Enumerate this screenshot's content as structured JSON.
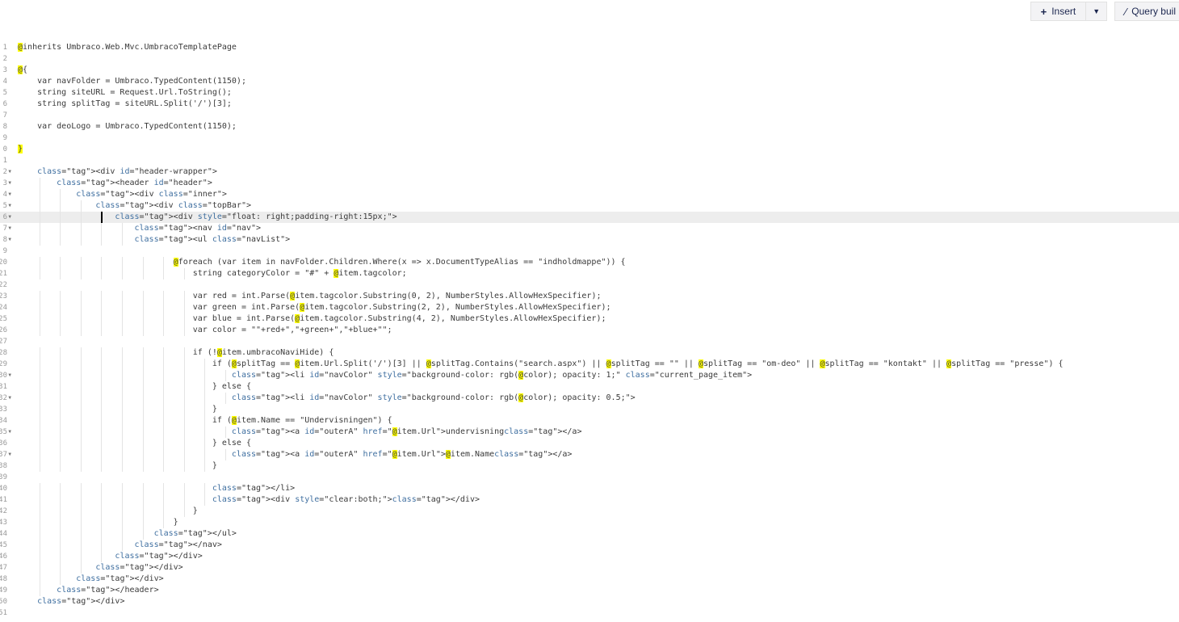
{
  "toolbar": {
    "insert_icon": "plus-icon",
    "insert_label": "Insert",
    "dropdown_icon": "caret-down-icon",
    "query_icon": "wand-icon",
    "query_label": "Query buil"
  },
  "editor": {
    "lines": [
      {
        "n": "1",
        "t": "@inherits Umbraco.Web.Mvc.UmbracoTemplatePage"
      },
      {
        "n": "2",
        "t": ""
      },
      {
        "n": "3",
        "t": "@{"
      },
      {
        "n": "4",
        "t": "    var navFolder = Umbraco.TypedContent(1150);"
      },
      {
        "n": "5",
        "t": "    string siteURL = Request.Url.ToString();"
      },
      {
        "n": "6",
        "t": "    string splitTag = siteURL.Split('/')[3];"
      },
      {
        "n": "7",
        "t": ""
      },
      {
        "n": "8",
        "t": "    var deoLogo = Umbraco.TypedContent(1150);"
      },
      {
        "n": "9",
        "t": ""
      },
      {
        "n": "0",
        "t": "}"
      },
      {
        "n": "1",
        "t": ""
      },
      {
        "n": "2",
        "t": "    <div id=\"header-wrapper\">",
        "fold": true
      },
      {
        "n": "3",
        "t": "        <header id=\"header\">",
        "fold": true
      },
      {
        "n": "4",
        "t": "            <div class=\"inner\">",
        "fold": true
      },
      {
        "n": "5",
        "t": "                <div class=\"topBar\">",
        "fold": true
      },
      {
        "n": "6",
        "t": "                    <div style=\"float: right;padding-right:15px;\">",
        "fold": true,
        "active": true
      },
      {
        "n": "7",
        "t": "                        <nav id=\"nav\">",
        "fold": true
      },
      {
        "n": "8",
        "t": "                        <ul class=\"navList\">",
        "fold": true
      },
      {
        "n": "9",
        "t": ""
      },
      {
        "n": "20",
        "t": "                                @foreach (var item in navFolder.Children.Where(x => x.DocumentTypeAlias == \"indholdmappe\")) {"
      },
      {
        "n": "21",
        "t": "                                    string categoryColor = \"#\" + @item.tagcolor;"
      },
      {
        "n": "22",
        "t": ""
      },
      {
        "n": "23",
        "t": "                                    var red = int.Parse(@item.tagcolor.Substring(0, 2), NumberStyles.AllowHexSpecifier);"
      },
      {
        "n": "24",
        "t": "                                    var green = int.Parse(@item.tagcolor.Substring(2, 2), NumberStyles.AllowHexSpecifier);"
      },
      {
        "n": "25",
        "t": "                                    var blue = int.Parse(@item.tagcolor.Substring(4, 2), NumberStyles.AllowHexSpecifier);"
      },
      {
        "n": "26",
        "t": "                                    var color = \"\"+red+\",\"+green+\",\"+blue+\"\";"
      },
      {
        "n": "27",
        "t": ""
      },
      {
        "n": "28",
        "t": "                                    if (!@item.umbracoNaviHide) {"
      },
      {
        "n": "29",
        "t": "                                        if (@splitTag == @item.Url.Split('/')[3] || @splitTag.Contains(\"search.aspx\") || @splitTag == \"\" || @splitTag == \"om-deo\" || @splitTag == \"kontakt\" || @splitTag == \"presse\") {"
      },
      {
        "n": "30",
        "t": "                                            <li id=\"navColor\" style=\"background-color: rgb(@color); opacity: 1;\" class=\"current_page_item\">",
        "fold": true
      },
      {
        "n": "31",
        "t": "                                        } else {"
      },
      {
        "n": "32",
        "t": "                                            <li id=\"navColor\" style=\"background-color: rgb(@color); opacity: 0.5;\">",
        "fold": true
      },
      {
        "n": "33",
        "t": "                                        }"
      },
      {
        "n": "34",
        "t": "                                        if (@item.Name == \"Undervisningen\") {"
      },
      {
        "n": "35",
        "t": "                                            <a id=\"outerA\" href=\"@item.Url\">undervisning</a>",
        "fold": true
      },
      {
        "n": "36",
        "t": "                                        } else {"
      },
      {
        "n": "37",
        "t": "                                            <a id=\"outerA\" href=\"@item.Url\">@item.Name</a>",
        "fold": true
      },
      {
        "n": "38",
        "t": "                                        }"
      },
      {
        "n": "39",
        "t": ""
      },
      {
        "n": "40",
        "t": "                                        </li>"
      },
      {
        "n": "41",
        "t": "                                        <div style=\"clear:both;\"></div>"
      },
      {
        "n": "42",
        "t": "                                    }"
      },
      {
        "n": "43",
        "t": "                                }"
      },
      {
        "n": "44",
        "t": "                            </ul>"
      },
      {
        "n": "45",
        "t": "                        </nav>"
      },
      {
        "n": "46",
        "t": "                    </div>"
      },
      {
        "n": "47",
        "t": "                </div>"
      },
      {
        "n": "48",
        "t": "            </div>"
      },
      {
        "n": "49",
        "t": "        </header>"
      },
      {
        "n": "50",
        "t": "    </div>"
      },
      {
        "n": "51",
        "t": ""
      }
    ]
  }
}
